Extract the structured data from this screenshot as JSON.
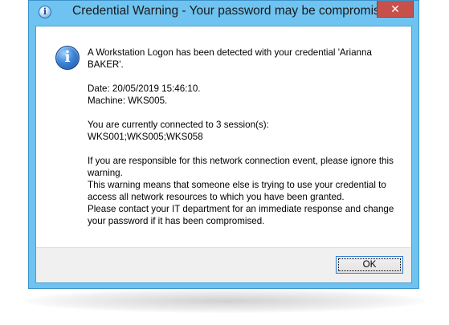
{
  "window": {
    "title": "Credential Warning - Your password may be compromised",
    "close_label": "✕",
    "title_icon": "info-icon"
  },
  "message": {
    "icon": "info-icon",
    "paragraphs": [
      [
        "A Workstation Logon has been detected with your credential 'Arianna BAKER'."
      ],
      [
        "Date: 20/05/2019 15:46:10.",
        "Machine: WKS005."
      ],
      [
        "You are currently connected to 3 session(s):",
        "WKS001;WKS005;WKS058"
      ],
      [
        "If you are responsible for this network connection event, please ignore this warning.",
        "This warning means that someone else is trying to use your credential to access all network resources to which you have been granted.",
        "Please contact your IT department for an immediate response and change your password if it has been compromised."
      ]
    ]
  },
  "buttons": {
    "ok_label": "OK"
  },
  "colors": {
    "frame": "#6fc3f0",
    "close_button": "#c7504b",
    "footer": "#f0f0f0",
    "focus_border": "#2e7bd6"
  }
}
